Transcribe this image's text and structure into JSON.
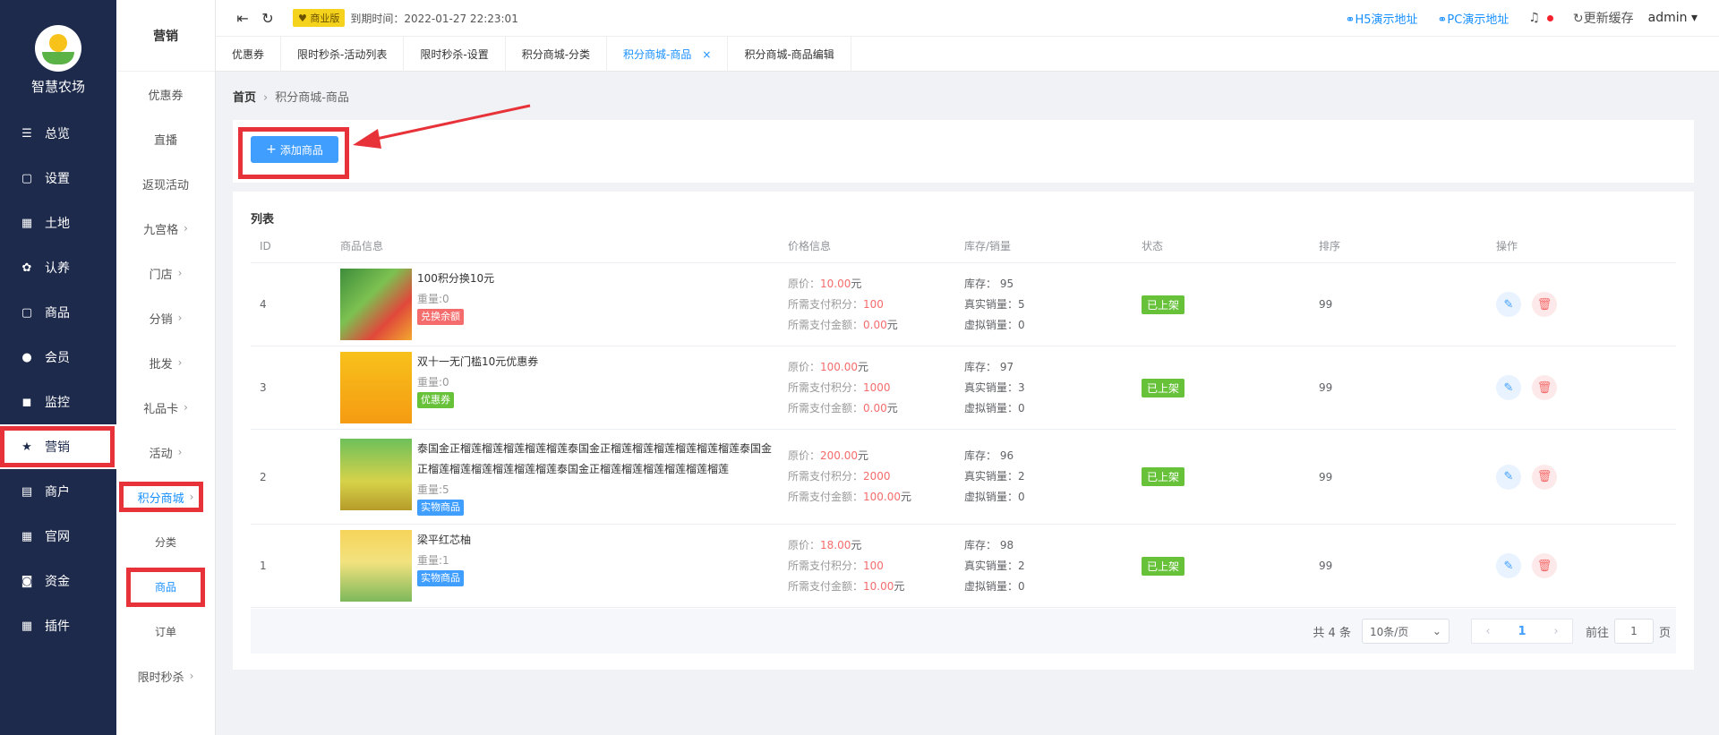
{
  "brand": {
    "name": "智慧农场"
  },
  "nav": {
    "items": [
      {
        "label": "总览",
        "icon": "sliders-icon",
        "glyph": "☰"
      },
      {
        "label": "设置",
        "icon": "bag-icon",
        "glyph": "▢"
      },
      {
        "label": "土地",
        "icon": "grid-icon",
        "glyph": "▦"
      },
      {
        "label": "认养",
        "icon": "flower-icon",
        "glyph": "✿"
      },
      {
        "label": "商品",
        "icon": "bag-icon",
        "glyph": "▢"
      },
      {
        "label": "会员",
        "icon": "user-icon",
        "glyph": "●"
      },
      {
        "label": "监控",
        "icon": "camera-icon",
        "glyph": "◼"
      },
      {
        "label": "营销",
        "icon": "star-icon",
        "glyph": "★"
      },
      {
        "label": "商户",
        "icon": "store-icon",
        "glyph": "▤"
      },
      {
        "label": "官网",
        "icon": "grid-icon",
        "glyph": "▦"
      },
      {
        "label": "资金",
        "icon": "money-icon",
        "glyph": "◙"
      },
      {
        "label": "插件",
        "icon": "grid-icon",
        "glyph": "▦"
      }
    ]
  },
  "subnav": {
    "title": "营销",
    "items": [
      "优惠券",
      "直播",
      "返现活动",
      "九宫格",
      "门店",
      "分销",
      "批发",
      "礼品卡",
      "活动",
      "积分商城",
      "分类",
      "商品",
      "订单",
      "限时秒杀"
    ]
  },
  "header": {
    "edition": "商业版",
    "expire_label": "到期时间：",
    "expire_value": "2022-01-27 22:23:01",
    "h5_link": "H5演示地址",
    "pc_link": "PC演示地址",
    "refresh_label": "更新缓存",
    "user": "admin"
  },
  "tabs": [
    "优惠券",
    "限时秒杀-活动列表",
    "限时秒杀-设置",
    "积分商城-分类",
    "积分商城-商品",
    "积分商城-商品编辑"
  ],
  "breadcrumb": {
    "home": "首页",
    "current": "积分商城-商品"
  },
  "actions": {
    "add_label": "添加商品"
  },
  "list": {
    "title": "列表",
    "columns": [
      "ID",
      "商品信息",
      "价格信息",
      "库存/销量",
      "状态",
      "排序",
      "操作"
    ],
    "price_labels": {
      "original": "原价：",
      "points": "所需支付积分：",
      "cash": "所需支付金额：",
      "unit": "元"
    },
    "stock_labels": {
      "stock": "库存：",
      "real": "真实销量：",
      "virtual": "虚拟销量："
    },
    "weight_label": "重量:",
    "rows": [
      {
        "id": "4",
        "name": "100积分换10元",
        "weight": "0",
        "tag": "兑换余额",
        "tag_color": "#f56c6c",
        "price": "10.00",
        "points": "100",
        "cash": "0.00",
        "stock": "95",
        "real": "5",
        "virtual": "0",
        "status": "已上架",
        "sort": "99"
      },
      {
        "id": "3",
        "name": "双十一无门槛10元优惠券",
        "weight": "0",
        "tag": "优惠券",
        "tag_color": "#67c23a",
        "price": "100.00",
        "points": "1000",
        "cash": "0.00",
        "stock": "97",
        "real": "3",
        "virtual": "0",
        "status": "已上架",
        "sort": "99"
      },
      {
        "id": "2",
        "name": "泰国金正榴莲榴莲榴莲榴莲榴莲泰国金正榴莲榴莲榴莲榴莲榴莲榴莲泰国金正榴莲榴莲榴莲榴莲榴莲榴莲泰国金正榴莲榴莲榴莲榴莲榴莲榴莲",
        "weight": "5",
        "tag": "实物商品",
        "tag_color": "#409eff",
        "price": "200.00",
        "points": "2000",
        "cash": "100.00",
        "stock": "96",
        "real": "2",
        "virtual": "0",
        "status": "已上架",
        "sort": "99"
      },
      {
        "id": "1",
        "name": "梁平红芯柚",
        "weight": "1",
        "tag": "实物商品",
        "tag_color": "#409eff",
        "price": "18.00",
        "points": "100",
        "cash": "10.00",
        "stock": "98",
        "real": "2",
        "virtual": "0",
        "status": "已上架",
        "sort": "99"
      }
    ]
  },
  "pagination": {
    "total": "共 4 条",
    "page_size": "10条/页",
    "current": "1",
    "goto_label": "前往",
    "goto_value": "1",
    "page_unit": "页"
  },
  "colors": {
    "sidebar": "#1d2a4b",
    "accent": "#409eff",
    "highlight": "#e8323a",
    "status": "#67c23a"
  }
}
